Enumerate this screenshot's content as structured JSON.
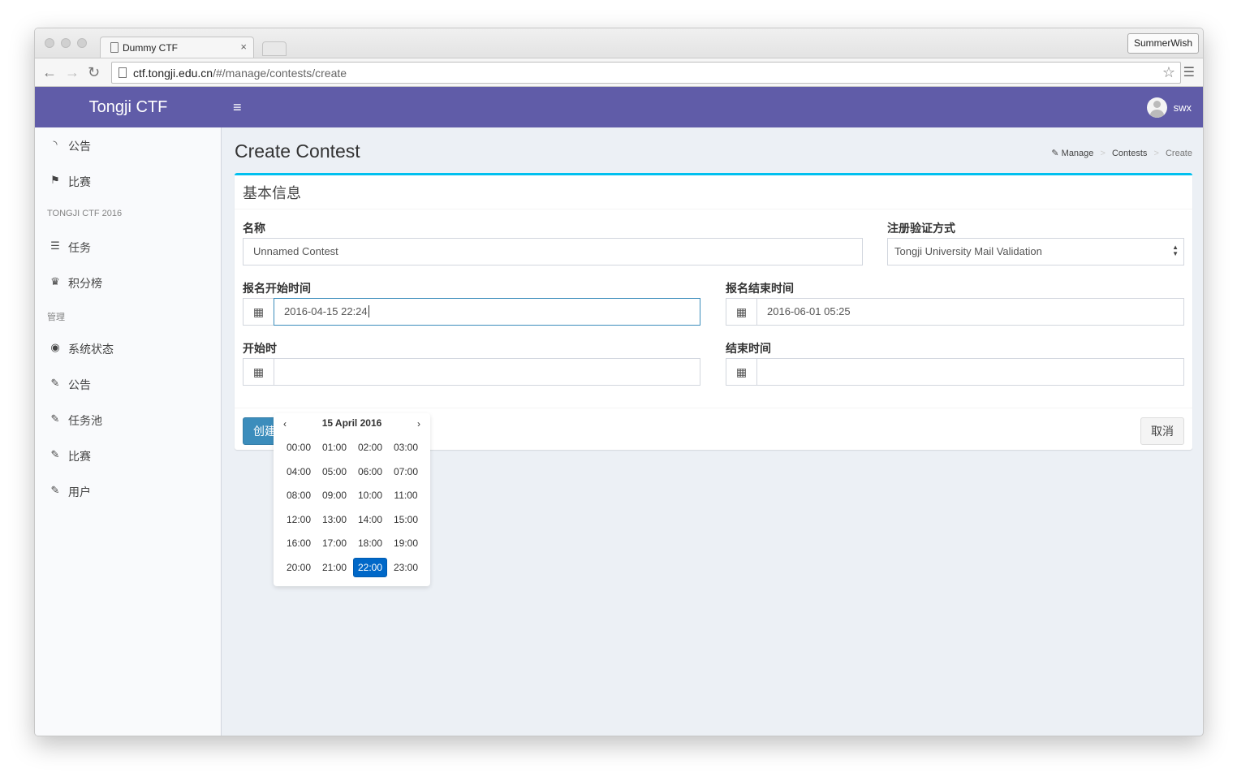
{
  "browser": {
    "tab_title": "Dummy CTF",
    "tab_close": "×",
    "profile": "SummerWish",
    "url_host": "ctf.tongji.edu.cn",
    "url_path": "/#/manage/contests/create"
  },
  "header": {
    "brand": "Tongji CTF",
    "menu_icon": "≡",
    "user": "swx"
  },
  "sidebar": {
    "items_top": [
      {
        "label": "公告",
        "icon": "rss-icon"
      },
      {
        "label": "比赛",
        "icon": "flag-icon"
      }
    ],
    "section1": "TONGJI CTF 2016",
    "items_mid": [
      {
        "label": "任务",
        "icon": "list-icon"
      },
      {
        "label": "积分榜",
        "icon": "trophy-icon"
      }
    ],
    "section2": "管理",
    "items_bottom": [
      {
        "label": "系统状态",
        "icon": "dashboard-icon"
      },
      {
        "label": "公告",
        "icon": "wrench-icon"
      },
      {
        "label": "任务池",
        "icon": "wrench-icon"
      },
      {
        "label": "比赛",
        "icon": "wrench-icon"
      },
      {
        "label": "用户",
        "icon": "wrench-icon"
      }
    ]
  },
  "page": {
    "title": "Create Contest",
    "breadcrumb": [
      "Manage",
      "Contests",
      "Create"
    ]
  },
  "form": {
    "box_title": "基本信息",
    "name_label": "名称",
    "name_value": "Unnamed Contest",
    "validation_label": "注册验证方式",
    "validation_value": "Tongji University Mail Validation",
    "reg_start_label": "报名开始时间",
    "reg_start_value": "2016-04-15 22:24",
    "reg_end_label": "报名结束时间",
    "reg_end_value": "2016-06-01 05:25",
    "start_label": "开始时",
    "start_value": "",
    "end_label": "结束时间",
    "end_value": "",
    "create_button": "创建",
    "cancel_button": "取消"
  },
  "picker": {
    "prev": "‹",
    "next": "›",
    "title": "15 April 2016",
    "hours": [
      "00:00",
      "01:00",
      "02:00",
      "03:00",
      "04:00",
      "05:00",
      "06:00",
      "07:00",
      "08:00",
      "09:00",
      "10:00",
      "11:00",
      "12:00",
      "13:00",
      "14:00",
      "15:00",
      "16:00",
      "17:00",
      "18:00",
      "19:00",
      "20:00",
      "21:00",
      "22:00",
      "23:00"
    ],
    "selected": "22:00"
  },
  "colors": {
    "header": "#605ca8",
    "box_accent": "#00c0ef",
    "primary": "#3c8dbc",
    "selected_hour": "#0068c8"
  }
}
